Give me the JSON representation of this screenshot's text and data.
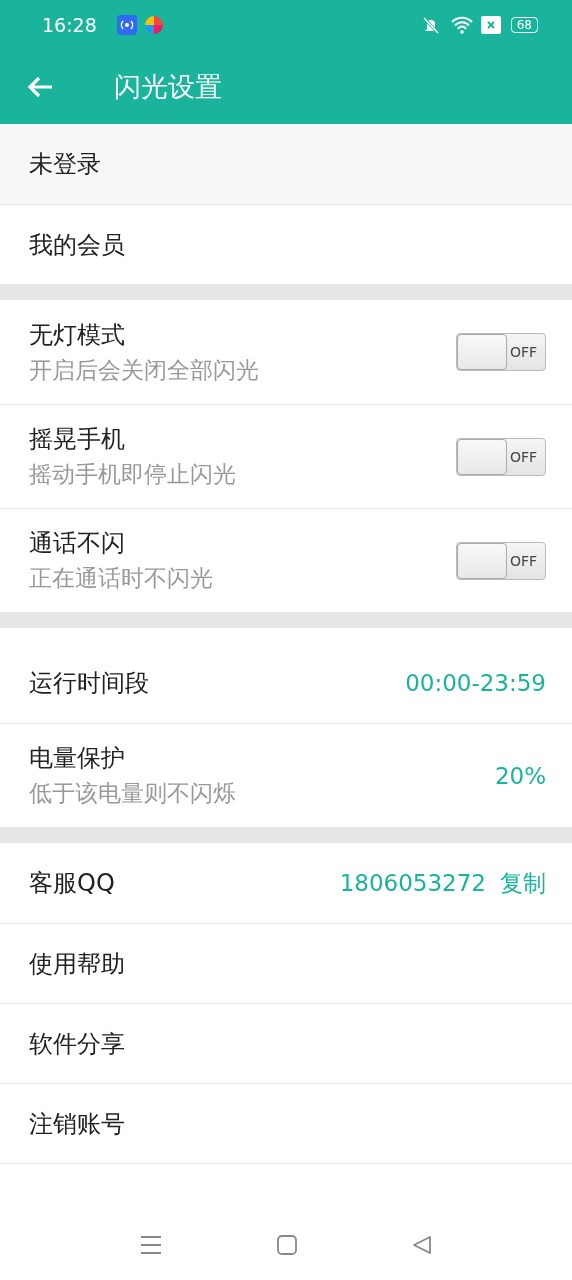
{
  "status_bar": {
    "time": "16:28",
    "battery": "68"
  },
  "header": {
    "title": "闪光设置"
  },
  "sections": [
    {
      "rows": [
        {
          "kind": "account",
          "title": "未登录"
        },
        {
          "kind": "link",
          "title": "我的会员"
        }
      ]
    },
    {
      "rows": [
        {
          "kind": "toggle",
          "title": "无灯模式",
          "subtitle": "开启后会关闭全部闪光",
          "on": false,
          "switch_label": "OFF"
        },
        {
          "kind": "toggle",
          "title": "摇晃手机",
          "subtitle": "摇动手机即停止闪光",
          "on": false,
          "switch_label": "OFF"
        },
        {
          "kind": "toggle",
          "title": "通话不闪",
          "subtitle": "正在通话时不闪光",
          "on": false,
          "switch_label": "OFF"
        }
      ]
    },
    {
      "rows": [
        {
          "kind": "value",
          "title": "运行时间段",
          "value": "00:00-23:59"
        },
        {
          "kind": "value",
          "title": "电量保护",
          "subtitle": "低于该电量则不闪烁",
          "value": "20%"
        }
      ]
    },
    {
      "rows": [
        {
          "kind": "qq",
          "title": "客服QQ",
          "value": "1806053272",
          "action": "复制"
        },
        {
          "kind": "link",
          "title": "使用帮助"
        },
        {
          "kind": "link",
          "title": "软件分享"
        },
        {
          "kind": "link",
          "title": "注销账号"
        }
      ]
    }
  ]
}
